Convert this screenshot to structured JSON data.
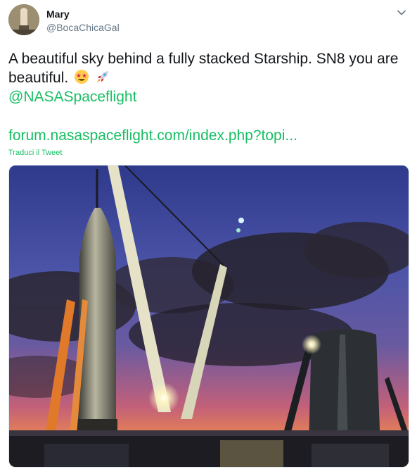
{
  "user": {
    "name": "Mary",
    "handle": "@BocaChicaGal"
  },
  "tweet": {
    "text": "A beautiful sky behind a fully stacked Starship. SN8 you are beautiful.",
    "emojis": [
      "star-struck-emoji",
      "rocket-emoji"
    ],
    "mention": "@NASASpaceflight",
    "link": "forum.nasaspaceflight.com/index.php?topi...",
    "translate_label": "Traduci il Tweet"
  },
  "colors": {
    "link": "#17bf63",
    "handle": "#657786",
    "text": "#14171a"
  },
  "icons": {
    "caret": "chevron-down-icon"
  }
}
